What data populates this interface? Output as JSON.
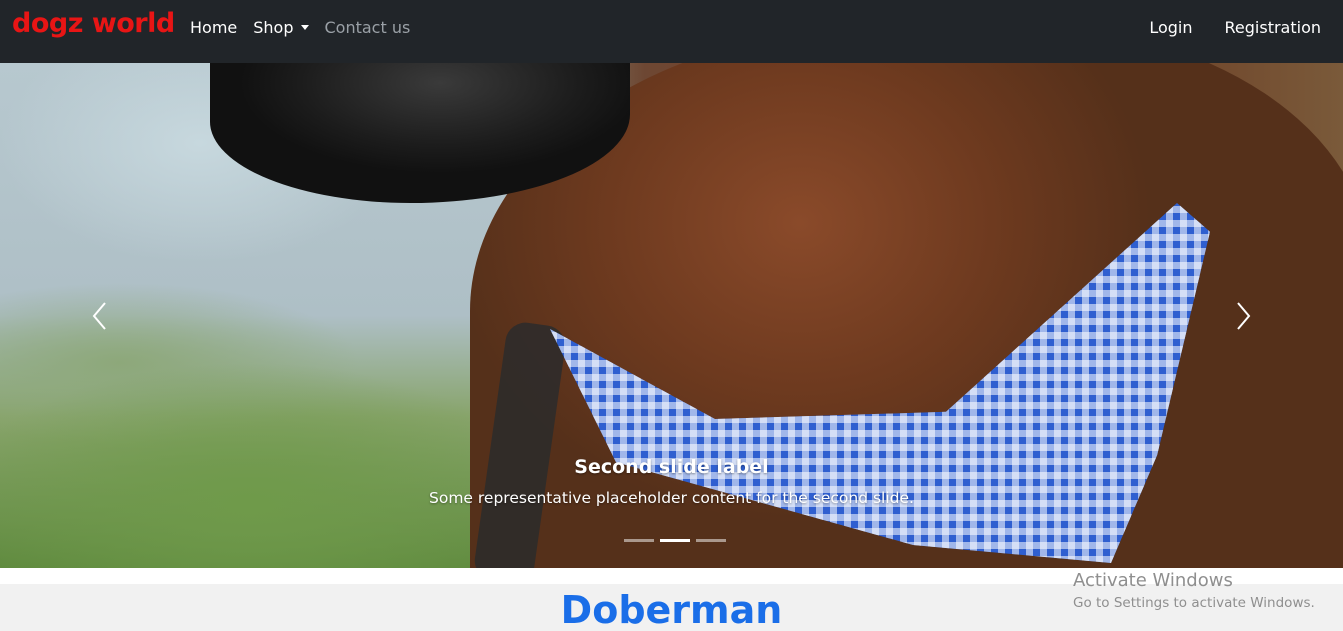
{
  "navbar": {
    "brand": "dogz world",
    "links": [
      {
        "label": "Home"
      },
      {
        "label": "Shop"
      },
      {
        "label": "Contact us"
      }
    ],
    "right_links": [
      {
        "label": "Login"
      },
      {
        "label": "Registration"
      }
    ],
    "colors": {
      "background": "#212529",
      "brand": "#e81515"
    }
  },
  "carousel": {
    "caption_title": "Second slide label",
    "caption_text": "Some representative placeholder content for the second slide.",
    "indicators": 3,
    "active_index": 1,
    "prev_icon": "chevron-left-icon",
    "next_icon": "chevron-right-icon"
  },
  "section": {
    "title": "Doberman",
    "title_color": "#1a6ee8"
  },
  "watermark": {
    "title": "Activate Windows",
    "subtitle": "Go to Settings to activate Windows."
  }
}
